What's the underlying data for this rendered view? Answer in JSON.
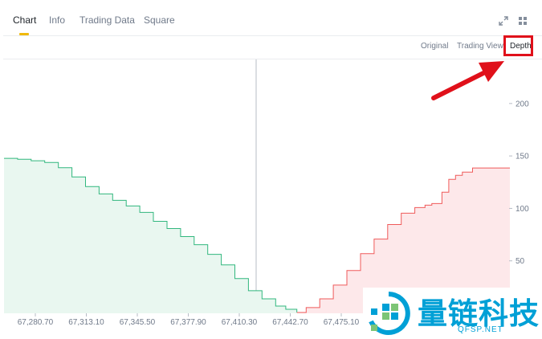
{
  "tabs": [
    {
      "label": "Chart",
      "active": true
    },
    {
      "label": "Info",
      "active": false
    },
    {
      "label": "Trading Data",
      "active": false
    },
    {
      "label": "Square",
      "active": false
    }
  ],
  "header_icons": [
    "expand-icon",
    "grid-layout-icon"
  ],
  "view_modes": [
    {
      "label": "Original",
      "active": false
    },
    {
      "label": "Trading View",
      "active": false
    },
    {
      "label": "Depth",
      "active": true
    }
  ],
  "annotation": {
    "arrow_color": "#e0101a",
    "highlight_color": "#e0101a"
  },
  "colors": {
    "bid_line": "#31b77e",
    "bid_fill": "#e9f7f0",
    "ask_line": "#ef5a5a",
    "ask_fill": "#fde8ea",
    "accent": "#f0b90b"
  },
  "watermark": {
    "title": "量链科技",
    "subtitle": "QFSP.NET",
    "color": "#00a0d6"
  },
  "chart_data": {
    "type": "area",
    "title": "",
    "xlabel": "",
    "ylabel": "",
    "x_ticks": [
      "67,280.70",
      "67,313.10",
      "67,345.50",
      "67,377.90",
      "67,410.30",
      "67,442.70",
      "67,475.10"
    ],
    "y_ticks": [
      200,
      150,
      100,
      50
    ],
    "ylim": [
      0,
      242
    ],
    "xlim": [
      67254.0,
      67552.0
    ],
    "mid_price": 67426.5,
    "grid": false,
    "series": [
      {
        "side": "bid",
        "x": [
          67254.0,
          67262.0,
          67270.0,
          67278.0,
          67286.0,
          67294.0,
          67302.0,
          67310.0,
          67318.0,
          67326.0,
          67334.0,
          67342.0,
          67350.0,
          67358.0,
          67366.0,
          67374.0,
          67382.0,
          67390.0,
          67398.0,
          67406.0,
          67414.0,
          67420.0,
          67426.5
        ],
        "y": [
          147.7,
          146.9,
          145.4,
          143.8,
          138.8,
          130.0,
          120.8,
          113.8,
          107.7,
          102.3,
          96.2,
          87.7,
          80.8,
          73.1,
          65.4,
          56.2,
          46.2,
          33.1,
          21.5,
          13.8,
          6.9,
          3.8,
          0.8
        ]
      },
      {
        "side": "ask",
        "x": [
          67426.5,
          67432.0,
          67440.0,
          67448.0,
          67456.0,
          67464.0,
          67472.0,
          67480.0,
          67488.0,
          67496.0,
          67502.0,
          67506.0,
          67510.0,
          67512.0,
          67516.0,
          67520.0,
          67524.0,
          67530.0,
          67536.0,
          67544.0,
          67552.0
        ],
        "y": [
          0.8,
          5.4,
          13.8,
          26.9,
          40.8,
          56.9,
          70.8,
          84.6,
          95.4,
          100.8,
          103.1,
          104.6,
          104.6,
          115.4,
          127.7,
          131.5,
          134.6,
          138.5,
          138.5,
          138.5,
          138.5
        ]
      }
    ]
  }
}
